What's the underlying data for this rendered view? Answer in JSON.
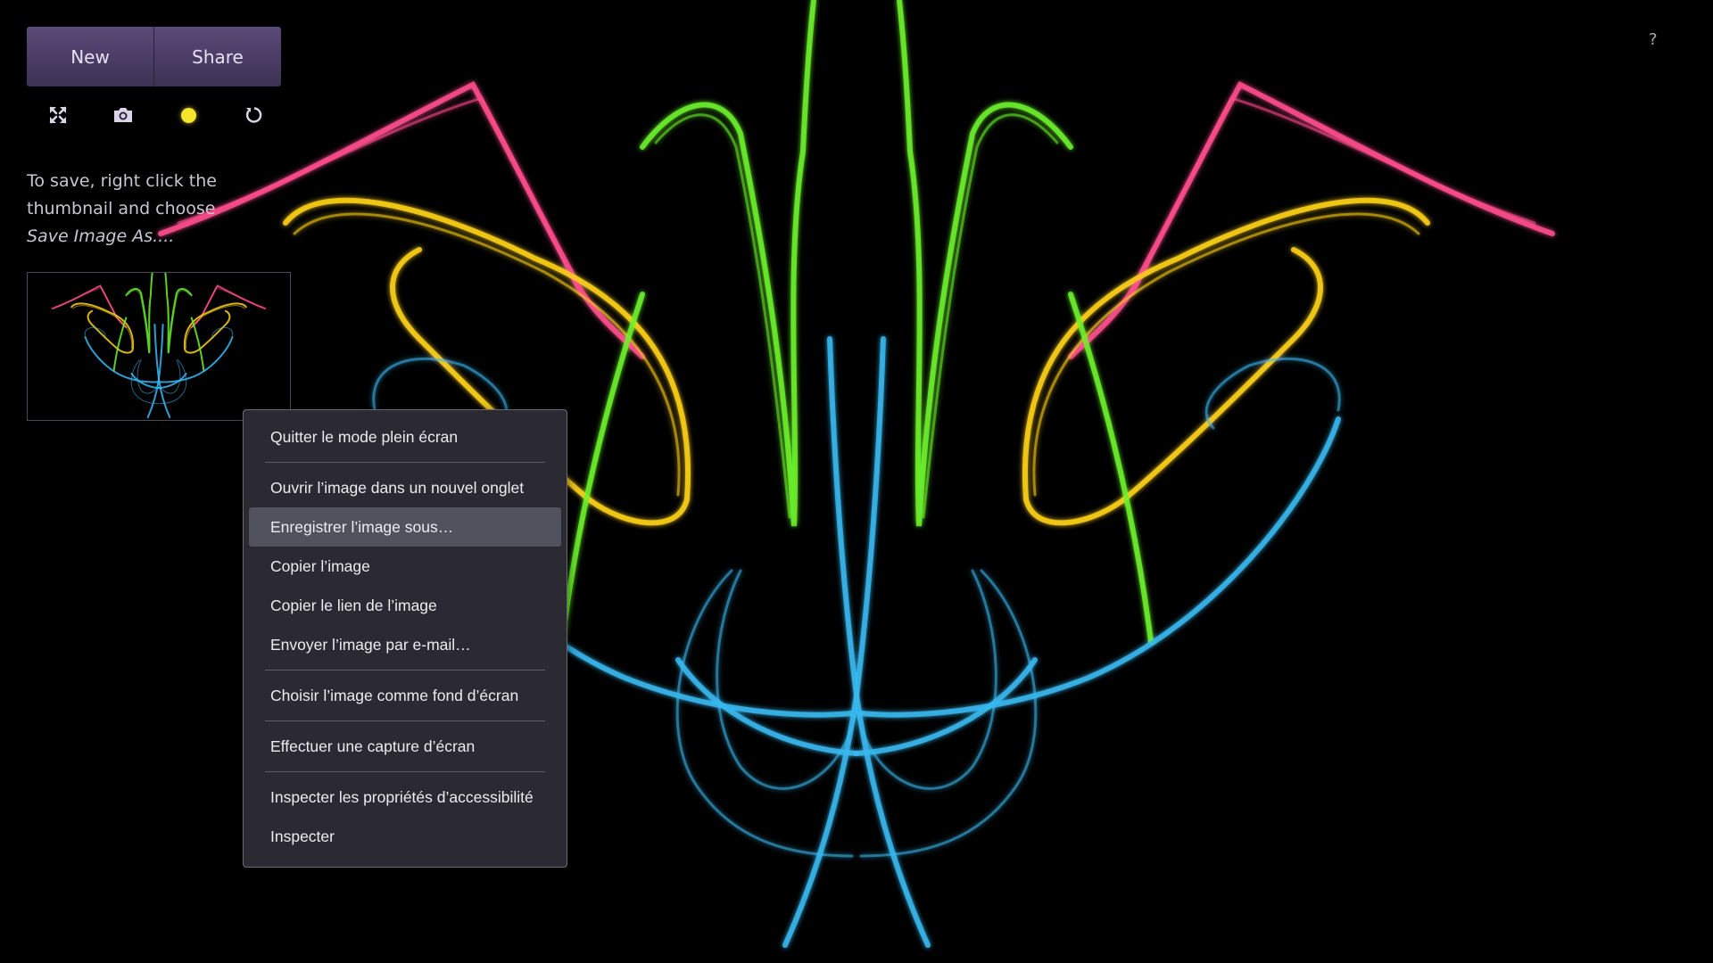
{
  "toolbar": {
    "new_label": "New",
    "share_label": "Share",
    "icons": [
      "fullscreen-icon",
      "camera-icon",
      "sun-icon",
      "reset-icon"
    ],
    "sun_color": "#f5e52c",
    "button_color": "#4b3d66"
  },
  "hint": {
    "line1": "To save, right click the thumbnail and choose",
    "line2": "Save Image As...."
  },
  "help_label": "?",
  "context_menu": {
    "items": [
      {
        "label": "Quitter le mode plein écran"
      },
      {
        "label": "Ouvrir l’image dans un nouvel onglet"
      },
      {
        "label": "Enregistrer l’image sous…",
        "highlighted": true
      },
      {
        "label": "Copier l’image"
      },
      {
        "label": "Copier le lien de l’image"
      },
      {
        "label": "Envoyer l’image par e-mail…"
      },
      {
        "label": "Choisir l’image comme fond d’écran"
      },
      {
        "label": "Effectuer une capture d’écran"
      },
      {
        "label": "Inspecter les propriétés d’accessibilité"
      },
      {
        "label": "Inspecter"
      }
    ]
  },
  "artwork": {
    "colors": {
      "pink": "#ff4d8c",
      "yellow": "#ffd21a",
      "green": "#6cf22c",
      "blue": "#38b8f0"
    }
  }
}
